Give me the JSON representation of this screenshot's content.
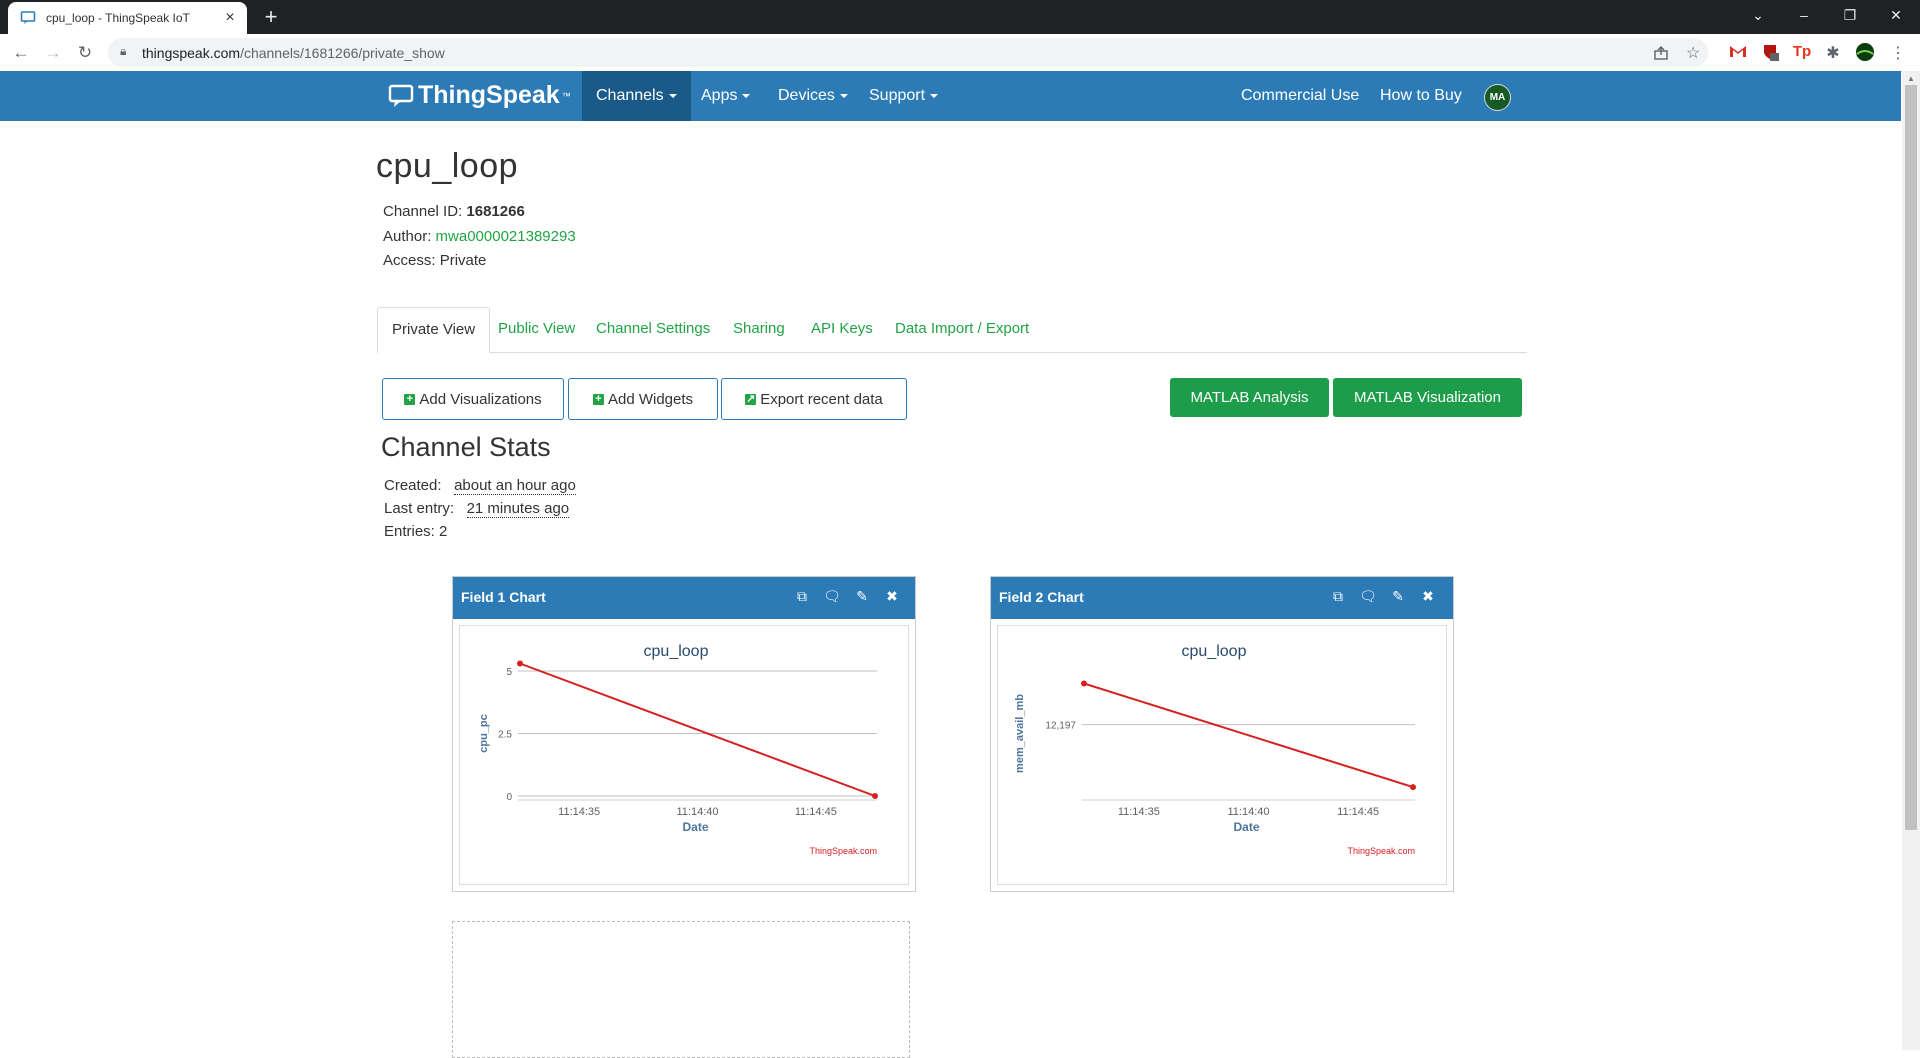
{
  "browser": {
    "tab_title": "cpu_loop - ThingSpeak IoT",
    "url_host": "thingspeak.com",
    "url_path": "/channels/1681266/private_show",
    "win_controls": [
      "⌄",
      "–",
      "❐",
      "✕"
    ]
  },
  "nav": {
    "brand": "ThingSpeak",
    "trademark": "™",
    "items": [
      {
        "label": "Channels"
      },
      {
        "label": "Apps"
      },
      {
        "label": "Devices"
      },
      {
        "label": "Support"
      }
    ],
    "right_items": [
      {
        "label": "Commercial Use"
      },
      {
        "label": "How to Buy"
      }
    ],
    "avatar": "MA"
  },
  "channel": {
    "title": "cpu_loop",
    "id_label": "Channel ID:",
    "id": "1681266",
    "author_label": "Author:",
    "author": "mwa0000021389293",
    "access_label": "Access:",
    "access": "Private"
  },
  "tabs": [
    "Private View",
    "Public View",
    "Channel Settings",
    "Sharing",
    "API Keys",
    "Data Import / Export"
  ],
  "buttons": {
    "add_visualizations": "Add Visualizations",
    "add_widgets": "Add Widgets",
    "export_recent": "Export recent data",
    "matlab_analysis": "MATLAB Analysis",
    "matlab_visualization": "MATLAB Visualization"
  },
  "stats": {
    "title": "Channel Stats",
    "created_label": "Created:",
    "created": "about an hour ago",
    "last_entry_label": "Last entry:",
    "last_entry": "21 minutes ago",
    "entries_label": "Entries:",
    "entries": "2"
  },
  "widgets": [
    {
      "title": "Field 1 Chart"
    },
    {
      "title": "Field 2 Chart"
    }
  ],
  "colors": {
    "nav_blue": "#2c7bb6",
    "green": "#1d9c49",
    "series": "#d62020"
  },
  "chart_data": [
    {
      "type": "line",
      "title": "cpu_loop",
      "xlabel": "Date",
      "ylabel": "cpu_pc",
      "x_ticks": [
        "11:14:35",
        "11:14:40",
        "11:14:45"
      ],
      "y_ticks": [
        "0",
        "2.5",
        "5"
      ],
      "ylim": [
        0,
        5
      ],
      "x": [
        "11:14:32.5",
        "11:14:47.5"
      ],
      "series": [
        {
          "values": [
            5.3,
            0
          ]
        }
      ],
      "credit": "ThingSpeak.com",
      "grid": true
    },
    {
      "type": "line",
      "title": "cpu_loop",
      "xlabel": "Date",
      "ylabel": "mem_avail_mb",
      "x_ticks": [
        "11:14:35",
        "11:14:40",
        "11:14:45"
      ],
      "y_ticks": [
        "12,197"
      ],
      "ylim": [
        12196.6,
        12197.3
      ],
      "x": [
        "11:14:32.5",
        "11:14:47.5"
      ],
      "series": [
        {
          "values": [
            12197.23,
            12196.65
          ]
        }
      ],
      "credit": "ThingSpeak.com",
      "grid": true
    }
  ]
}
